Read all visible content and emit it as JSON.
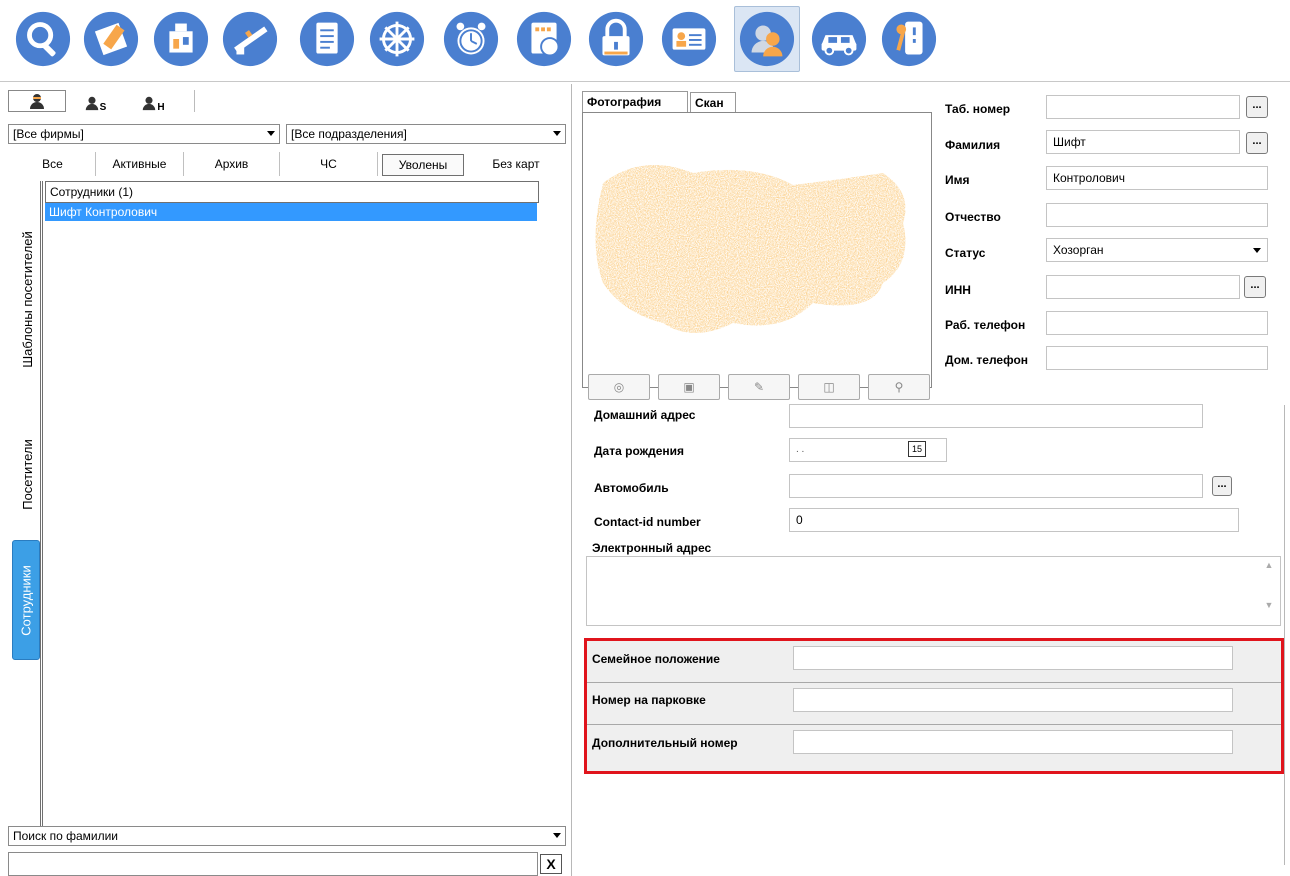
{
  "toolbar": {
    "icons": [
      "search-icon",
      "plan-map-icon",
      "access-device-icon",
      "barrier-icon",
      "document-icon",
      "helm-icon",
      "alarm-clock-icon",
      "report-clock-icon",
      "lock-icon",
      "id-card-icon",
      "person-icon",
      "car-icon",
      "key-pad-icon"
    ],
    "active_index": 10
  },
  "left": {
    "subtabs": [
      "",
      "S",
      "H"
    ],
    "company_combo": "[Все фирмы]",
    "department_combo": "[Все подразделения]",
    "filter_tabs": [
      "Все",
      "Активные",
      "Архив",
      "ЧС",
      "Уволены",
      "Без карт"
    ],
    "selected_filter": "Уволены",
    "vertical_tabs": [
      "Шаблоны посетителей",
      "Посетители",
      "Сотрудники"
    ],
    "list_header": "Сотрудники (1)",
    "list_rows": [
      "Шифт Контролович"
    ],
    "search_mode": "Поиск по фамилии",
    "search_value": "",
    "clear_label": "X"
  },
  "photo": {
    "tabs": [
      "Фотография",
      "Скан"
    ],
    "active_tab": "Фотография"
  },
  "fields": {
    "tab_number": {
      "label": "Таб. номер",
      "value": ""
    },
    "last_name": {
      "label": "Фамилия",
      "value": "Шифт"
    },
    "first_name": {
      "label": "Имя",
      "value": "Контролович"
    },
    "patronymic": {
      "label": "Отчество",
      "value": ""
    },
    "status": {
      "label": "Статус",
      "value": "Хозорган"
    },
    "inn": {
      "label": "ИНН",
      "value": ""
    },
    "work_phone": {
      "label": "Раб. телефон",
      "value": ""
    },
    "home_phone": {
      "label": "Дом. телефон",
      "value": ""
    },
    "home_address": {
      "label": "Домашний адрес",
      "value": ""
    },
    "birth_date": {
      "label": "Дата рождения",
      "value": ". .",
      "calendar": "15"
    },
    "car": {
      "label": "Автомобиль",
      "value": ""
    },
    "contact_id": {
      "label": "Contact-id number",
      "value": "0"
    },
    "email": {
      "label": "Электронный адрес",
      "value": ""
    },
    "marital_status": {
      "label": "Семейное положение",
      "value": ""
    },
    "parking_number": {
      "label": "Номер на парковке",
      "value": ""
    },
    "extra_number": {
      "label": "Дополнительный номер",
      "value": ""
    },
    "ellipsis": "..."
  },
  "colors": {
    "selection": "#3399ff",
    "highlight": "#e0141c",
    "icon_blue": "#4a7fd0",
    "photo_orange": "#f7a64a"
  }
}
